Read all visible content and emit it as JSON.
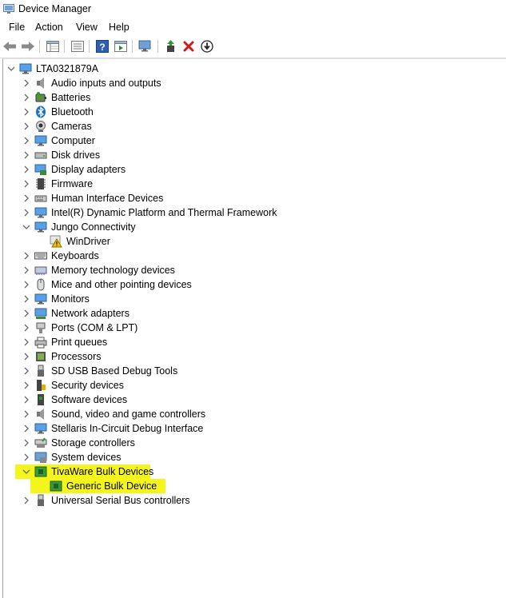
{
  "window": {
    "title": "Device Manager"
  },
  "menu": {
    "items": [
      "File",
      "Action",
      "View",
      "Help"
    ]
  },
  "toolbar": {
    "buttons": [
      "back-arrow-icon",
      "forward-arrow-icon",
      "properties-grid-icon",
      "driver-details-icon",
      "help-icon",
      "update-driver-icon",
      "scan-hardware-monitor-icon",
      "enable-device-icon",
      "uninstall-x-icon",
      "disable-down-icon"
    ]
  },
  "tree": {
    "root": "LTA0321879A",
    "categories": [
      {
        "label": "Audio inputs and outputs",
        "icon": "speaker-icon",
        "expanded": false
      },
      {
        "label": "Batteries",
        "icon": "battery-icon",
        "expanded": false
      },
      {
        "label": "Bluetooth",
        "icon": "bluetooth-icon",
        "expanded": false
      },
      {
        "label": "Cameras",
        "icon": "camera-icon",
        "expanded": false
      },
      {
        "label": "Computer",
        "icon": "computer-icon",
        "expanded": false
      },
      {
        "label": "Disk drives",
        "icon": "disk-drive-icon",
        "expanded": false
      },
      {
        "label": "Display adapters",
        "icon": "display-adapter-icon",
        "expanded": false
      },
      {
        "label": "Firmware",
        "icon": "firmware-chip-icon",
        "expanded": false
      },
      {
        "label": "Human Interface Devices",
        "icon": "hid-icon",
        "expanded": false
      },
      {
        "label": "Intel(R) Dynamic Platform and Thermal Framework",
        "icon": "monitor-icon",
        "expanded": false
      },
      {
        "label": "Jungo Connectivity",
        "icon": "monitor-icon",
        "expanded": true,
        "children": [
          {
            "label": "WinDriver",
            "icon": "warning-icon"
          }
        ]
      },
      {
        "label": "Keyboards",
        "icon": "keyboard-icon",
        "expanded": false
      },
      {
        "label": "Memory technology devices",
        "icon": "memory-icon",
        "expanded": false
      },
      {
        "label": "Mice and other pointing devices",
        "icon": "mouse-icon",
        "expanded": false
      },
      {
        "label": "Monitors",
        "icon": "monitor-icon",
        "expanded": false
      },
      {
        "label": "Network adapters",
        "icon": "network-icon",
        "expanded": false
      },
      {
        "label": "Ports (COM & LPT)",
        "icon": "port-icon",
        "expanded": false
      },
      {
        "label": "Print queues",
        "icon": "printer-icon",
        "expanded": false
      },
      {
        "label": "Processors",
        "icon": "processor-icon",
        "expanded": false
      },
      {
        "label": "SD USB Based Debug Tools",
        "icon": "usb-plug-icon",
        "expanded": false
      },
      {
        "label": "Security devices",
        "icon": "security-icon",
        "expanded": false
      },
      {
        "label": "Software devices",
        "icon": "software-icon",
        "expanded": false
      },
      {
        "label": "Sound, video and game controllers",
        "icon": "speaker-icon",
        "expanded": false
      },
      {
        "label": "Stellaris In-Circuit Debug Interface",
        "icon": "monitor-icon",
        "expanded": false
      },
      {
        "label": "Storage controllers",
        "icon": "storage-icon",
        "expanded": false
      },
      {
        "label": "System devices",
        "icon": "system-icon",
        "expanded": false
      },
      {
        "label": "TivaWare Bulk Devices",
        "icon": "board-icon",
        "expanded": true,
        "highlighted": true,
        "children": [
          {
            "label": "Generic Bulk Device",
            "icon": "board-icon",
            "highlighted": true
          }
        ]
      },
      {
        "label": "Universal Serial Bus controllers",
        "icon": "usb-plug-icon",
        "expanded": false
      }
    ]
  },
  "colors": {
    "highlight": "#f5f51e",
    "accent_green": "#2e8b2e",
    "accent_blue": "#2b7cd3",
    "delete_red": "#d11a1a"
  }
}
